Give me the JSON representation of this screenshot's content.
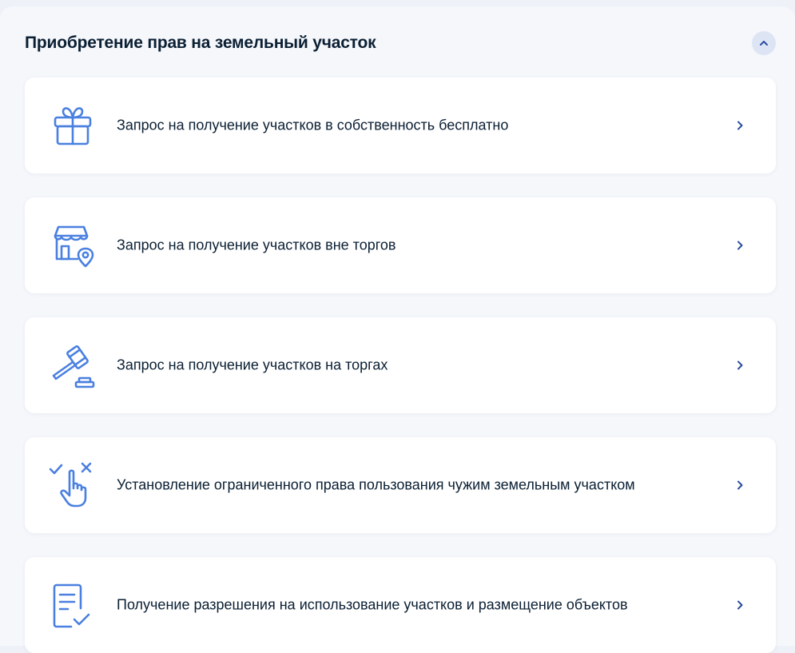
{
  "section": {
    "title": "Приобретение прав на земельный участок"
  },
  "colors": {
    "accent": "#4a80e0",
    "chevron": "#2a4f9e",
    "text": "#0b1f33"
  },
  "items": [
    {
      "label": "Запрос на получение участков в собственность бесплатно",
      "icon": "gift-icon"
    },
    {
      "label": "Запрос на получение участков вне торгов",
      "icon": "building-location-icon"
    },
    {
      "label": "Запрос на получение участков на торгах",
      "icon": "gavel-icon"
    },
    {
      "label": "Установление ограниченного права пользования чужим земельным участком",
      "icon": "hand-choice-icon"
    },
    {
      "label": "Получение разрешения на использование участков и размещение объектов",
      "icon": "document-check-icon"
    }
  ]
}
